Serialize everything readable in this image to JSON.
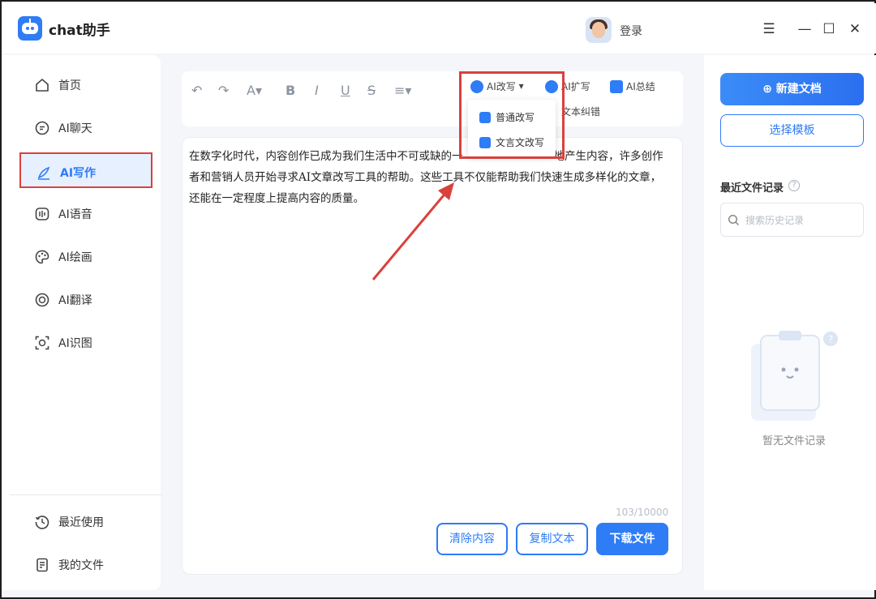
{
  "app": {
    "title": "chat助手",
    "login_label": "登录"
  },
  "window_controls": [
    {
      "name": "menu-icon",
      "glyph": "☰"
    },
    {
      "name": "minimize-icon",
      "glyph": "—"
    },
    {
      "name": "maximize-icon",
      "glyph": "☐"
    },
    {
      "name": "close-icon",
      "glyph": "✕"
    }
  ],
  "sidebar": {
    "items": [
      {
        "label": "首页",
        "icon": "home-icon"
      },
      {
        "label": "AI聊天",
        "icon": "chat-icon"
      },
      {
        "label": "AI写作",
        "icon": "pen-icon",
        "active": true
      },
      {
        "label": "AI语音",
        "icon": "voice-icon"
      },
      {
        "label": "AI绘画",
        "icon": "palette-icon"
      },
      {
        "label": "AI翻译",
        "icon": "translate-icon"
      },
      {
        "label": "AI识图",
        "icon": "image-recognition-icon"
      }
    ],
    "bottom_items": [
      {
        "label": "最近使用",
        "icon": "history-icon"
      },
      {
        "label": "我的文件",
        "icon": "file-icon"
      }
    ]
  },
  "toolbar": {
    "format_icons": [
      "undo-icon",
      "redo-icon",
      "font-color-icon",
      "bold-icon",
      "italic-icon",
      "underline-icon",
      "strikethrough-icon",
      "align-icon"
    ],
    "ai_rewrite": "AI改写",
    "ai_expand": "AI扩写",
    "ai_summary": "AI总结",
    "text_correction": "文本纠错"
  },
  "dropdown": {
    "items": [
      "普通改写",
      "文言文改写"
    ]
  },
  "editor": {
    "content_line1": "在数字化时代，内容创作已成为我们生活中不可或缺的一",
    "content_line1_tail": "地产生内容，许多创作",
    "content_line2": "者和营销人员开始寻求AI文章改写工具的帮助。这些工具不仅能帮助我们快速生成多样化的文章，",
    "content_line3": "还能在一定程度上提高内容的质量。",
    "char_count": "103/10000",
    "clear_button": "清除内容",
    "copy_button": "复制文本",
    "download_button": "下载文件"
  },
  "right_panel": {
    "new_doc_button": "新建文档",
    "template_button": "选择模板",
    "recent_title": "最近文件记录",
    "search_placeholder": "搜索历史记录",
    "empty_text": "暂无文件记录"
  },
  "colors": {
    "accent": "#2e7cf6",
    "highlight_red": "#d9413b"
  }
}
